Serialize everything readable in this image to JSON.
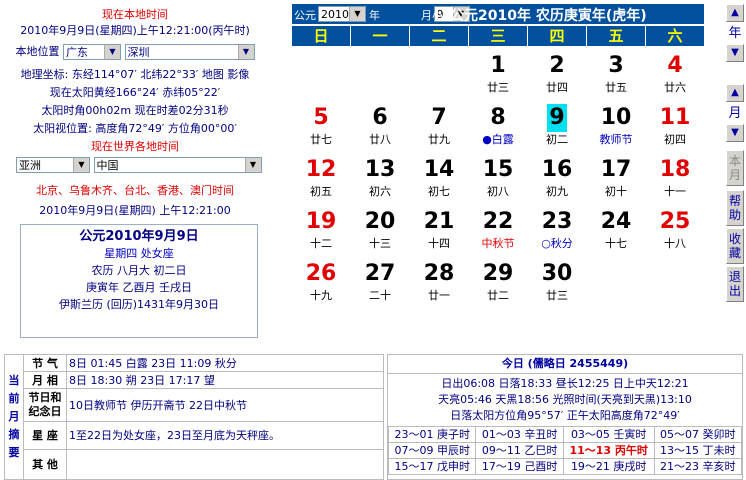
{
  "local": {
    "title": "现在本地时间",
    "datetime": "2010年9月9日(星期四)上午12:21:00(丙午时)",
    "location_label": "本地位置",
    "province": "广东",
    "city": "深圳",
    "coords": "地理坐标: 东经114°07′  北纬22°33′  地图  影像",
    "sun_lon": "现在太阳黄经166°24′  赤纬05°22′",
    "solar_time": "太阳时角00h02m  现在时差02分31秒",
    "sun_pos": "太阳视位置: 高度角72°49′  方位角00°00′"
  },
  "world": {
    "title": "现在世界各地时间",
    "region": "亚洲",
    "country": "中国",
    "cities": "北京、乌鲁木齐、台北、香港、澳门时间",
    "datetime": "2010年9月9日(星期四) 上午12:21:00"
  },
  "infobox": {
    "line1": "公元2010年9月9日",
    "line2": "星期四  处女座",
    "line3": "农历  八月大  初二日",
    "line4": "庚寅年  乙酉月  壬戌日",
    "line5": "伊斯兰历 (回历)1431年9月30日"
  },
  "header": {
    "prefix": "公元",
    "year": "2010",
    "year_suffix": "年",
    "month": "9",
    "month_suffix": "月小",
    "title": "公元2010年  农历庚寅年(虎年)"
  },
  "weekdays": [
    "日",
    "一",
    "二",
    "三",
    "四",
    "五",
    "六"
  ],
  "days": [
    {
      "d": "1",
      "l": "廿三",
      "col": 3,
      "row": 0
    },
    {
      "d": "2",
      "l": "廿四",
      "col": 4,
      "row": 0
    },
    {
      "d": "3",
      "l": "廿五",
      "col": 5,
      "row": 0
    },
    {
      "d": "4",
      "l": "廿六",
      "col": 6,
      "row": 0,
      "red": true
    },
    {
      "d": "5",
      "l": "廿七",
      "col": 0,
      "row": 1,
      "red": true
    },
    {
      "d": "6",
      "l": "廿八",
      "col": 1,
      "row": 1
    },
    {
      "d": "7",
      "l": "廿九",
      "col": 2,
      "row": 1
    },
    {
      "d": "8",
      "l": "●白露",
      "col": 3,
      "row": 1,
      "lblue": true
    },
    {
      "d": "9",
      "l": "初二",
      "col": 4,
      "row": 1,
      "today": true
    },
    {
      "d": "10",
      "l": "教师节",
      "col": 5,
      "row": 1,
      "lblue": true
    },
    {
      "d": "11",
      "l": "初四",
      "col": 6,
      "row": 1,
      "red": true
    },
    {
      "d": "12",
      "l": "初五",
      "col": 0,
      "row": 2,
      "red": true
    },
    {
      "d": "13",
      "l": "初六",
      "col": 1,
      "row": 2
    },
    {
      "d": "14",
      "l": "初七",
      "col": 2,
      "row": 2
    },
    {
      "d": "15",
      "l": "初八",
      "col": 3,
      "row": 2
    },
    {
      "d": "16",
      "l": "初九",
      "col": 4,
      "row": 2
    },
    {
      "d": "17",
      "l": "初十",
      "col": 5,
      "row": 2
    },
    {
      "d": "18",
      "l": "十一",
      "col": 6,
      "row": 2,
      "red": true
    },
    {
      "d": "19",
      "l": "十二",
      "col": 0,
      "row": 3,
      "red": true
    },
    {
      "d": "20",
      "l": "十三",
      "col": 1,
      "row": 3
    },
    {
      "d": "21",
      "l": "十四",
      "col": 2,
      "row": 3
    },
    {
      "d": "22",
      "l": "中秋节",
      "col": 3,
      "row": 3,
      "lred": true
    },
    {
      "d": "23",
      "l": "○秋分",
      "col": 4,
      "row": 3,
      "lblue": true
    },
    {
      "d": "24",
      "l": "十七",
      "col": 5,
      "row": 3
    },
    {
      "d": "25",
      "l": "十八",
      "col": 6,
      "row": 3,
      "red": true
    },
    {
      "d": "26",
      "l": "十九",
      "col": 0,
      "row": 4,
      "red": true
    },
    {
      "d": "27",
      "l": "二十",
      "col": 1,
      "row": 4
    },
    {
      "d": "28",
      "l": "廿一",
      "col": 2,
      "row": 4
    },
    {
      "d": "29",
      "l": "廿二",
      "col": 3,
      "row": 4
    },
    {
      "d": "30",
      "l": "廿三",
      "col": 4,
      "row": 4
    }
  ],
  "side": {
    "year": "年",
    "month": "月",
    "this_month": "本月",
    "help": "帮助",
    "fav": "收藏",
    "exit": "退出"
  },
  "bottom": {
    "side_label": "当前月摘要",
    "rows": [
      {
        "label": "节 气",
        "text": "8日 01:45 白露   23日 11:09 秋分"
      },
      {
        "label": "月 相",
        "text": "8日 18:30 朔   23日 17:17 望"
      },
      {
        "label": "节日和纪念日",
        "text": "10日教师节  伊历开斋节 22日中秋节"
      },
      {
        "label": "星 座",
        "text": "1至22日为处女座，23日至月底为天秤座。"
      },
      {
        "label": "其 他",
        "text": ""
      }
    ],
    "today_title": "今日 (儒略日 2455449)",
    "today_lines": [
      "日出06:08  日落18:33  昼长12:25  日上中天12:21",
      "天亮05:46  天黑18:56  光照时间(天亮到天黑)13:10",
      "日落太阳方位角95°57′  正午太阳高度角72°49′"
    ],
    "hours": [
      [
        "23～01 庚子时",
        "01～03 辛丑时",
        "03～05 壬寅时",
        "05～07 癸卯时"
      ],
      [
        "07～09 甲辰时",
        "09～11 乙巳时",
        "11～13 丙午时",
        "13～15 丁未时"
      ],
      [
        "15～17 戊申时",
        "17～19 己酉时",
        "19～21 庚戌时",
        "21～23 辛亥时"
      ]
    ]
  }
}
